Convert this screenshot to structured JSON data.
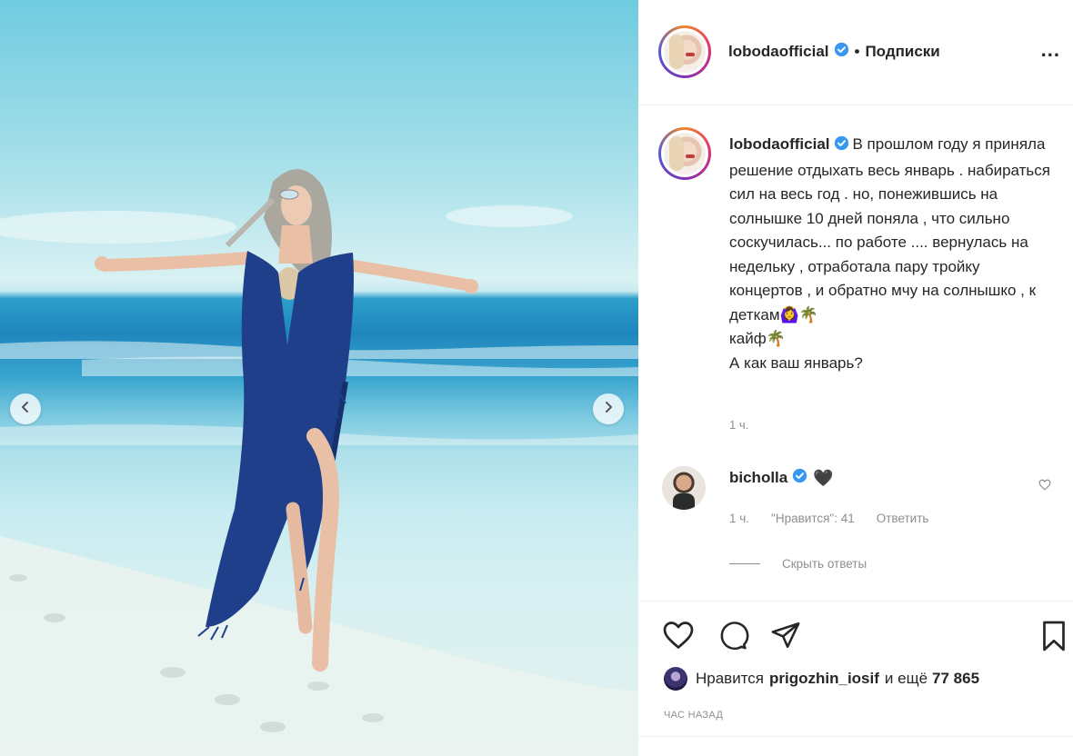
{
  "post": {
    "username": "lobodaofficial",
    "follow_state": "Подписки",
    "separator": "•",
    "more_label": "...",
    "caption": "В прошлом году я приняла решение отдыхать весь январь . набираться сил на весь год . но, понежившись на солнышке 10 дней поняла , что сильно соскучилась... по работе .... вернулась на недельку , отработала пару тройку концертов , и обратно мчу на солнышко , к деткам🙆‍♀️🌴\nкайф🌴\nА как ваш январь?",
    "caption_time": "1 ч."
  },
  "comment": {
    "username": "bicholla",
    "text": "🖤",
    "time": "1 ч.",
    "likes": "\"Нравится\": 41",
    "reply_label": "Ответить",
    "hide_replies": "Скрыть ответы"
  },
  "likes": {
    "prefix": "Нравится",
    "liker": "prigozhin_iosif",
    "joiner": "и ещё",
    "count": "77 865"
  },
  "posted_ago": "ЧАС НАЗАД",
  "icons": {
    "like": "heart-icon",
    "comment": "comment-bubble-icon",
    "share": "paper-plane-icon",
    "save": "bookmark-icon",
    "verified": "verified-badge-icon",
    "carousel_prev": "chevron-left-icon",
    "carousel_next": "chevron-right-icon"
  },
  "colors": {
    "verified": "#3897f0",
    "muted": "#8e8e8e",
    "text": "#262626"
  }
}
